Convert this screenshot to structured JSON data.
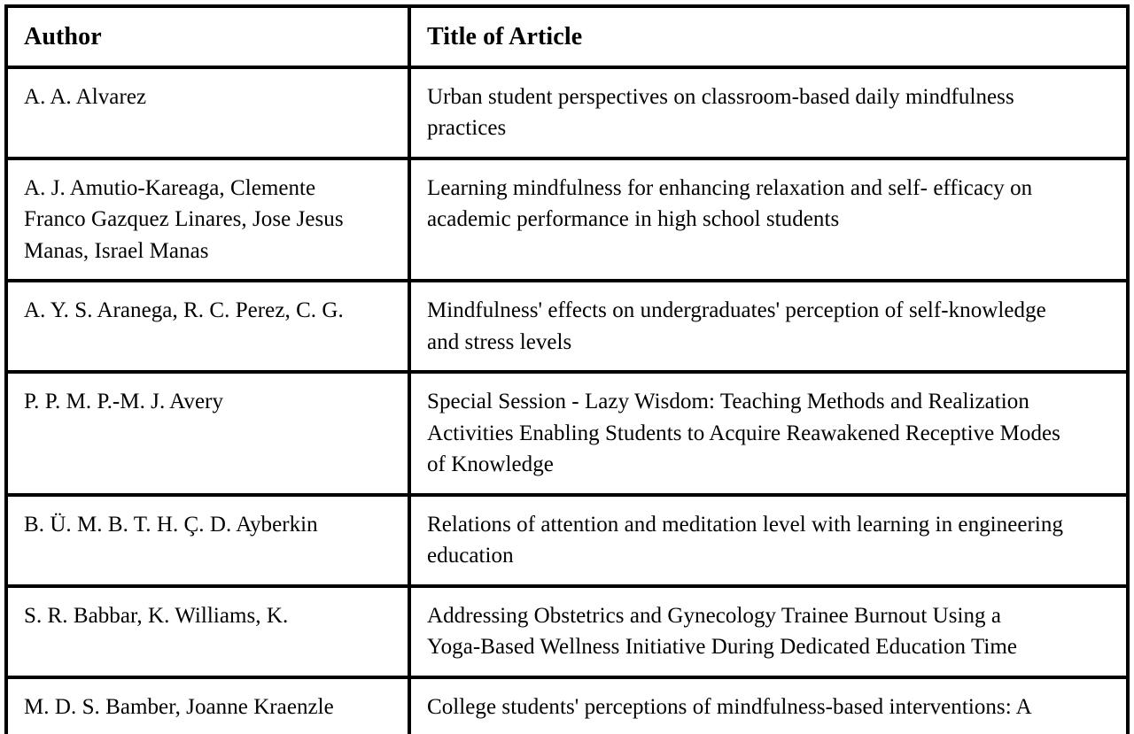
{
  "table": {
    "name": "author-title-table",
    "columns": [
      {
        "key": "author",
        "header": "Author"
      },
      {
        "key": "title",
        "header": "Title of Article"
      }
    ],
    "style": {
      "border_color": "#000000",
      "text_color": "#000000",
      "background": "#ffffff"
    },
    "rows": [
      {
        "author": "A. A. Alvarez",
        "title": "Urban student perspectives on classroom-based daily mindfulness practices",
        "author_lines": [
          "A. A. Alvarez"
        ],
        "title_lines": [
          "Urban student perspectives on classroom-based daily mindfulness",
          "practices"
        ]
      },
      {
        "author": "A. J. Amutio-Kareaga, Clemente Franco Gazquez Linares, Jose Jesus Manas, Israel Manas",
        "title": "Learning mindfulness for enhancing relaxation and self- efficacy on academic performance in high school students",
        "author_lines": [
          "A. J. Amutio-Kareaga, Clemente",
          "Franco Gazquez Linares, Jose Jesus",
          "Manas, Israel Manas"
        ],
        "title_lines": [
          "Learning mindfulness for enhancing relaxation and self- efficacy on",
          "academic performance in high school students"
        ]
      },
      {
        "author": "A. Y. S. Aranega, R. C. Perez, C. G.",
        "title": "Mindfulness' effects on undergraduates' perception of self-knowledge and stress levels",
        "author_lines": [
          "A. Y. S. Aranega, R. C. Perez, C. G."
        ],
        "title_lines": [
          "Mindfulness' effects on undergraduates' perception of self-knowledge",
          "and stress levels"
        ]
      },
      {
        "author": "P. P. M. P.-M. J. Avery",
        "title": "Special Session - Lazy Wisdom: Teaching Methods and Realization Activities Enabling Students to Acquire Reawakened Receptive Modes of Knowledge",
        "author_lines": [
          "P. P. M. P.-M. J. Avery"
        ],
        "title_lines": [
          "Special Session - Lazy Wisdom: Teaching Methods and Realization",
          "Activities Enabling Students to Acquire Reawakened Receptive Modes",
          "of Knowledge"
        ]
      },
      {
        "author": "B. Ü. M. B. T. H. Ç. D. Ayberkin",
        "title": "Relations of attention and meditation level with learning in engineering education",
        "author_lines": [
          "B. Ü. M. B. T. H. Ç. D. Ayberkin"
        ],
        "title_lines": [
          "Relations of attention and meditation level with learning in engineering",
          "education"
        ]
      },
      {
        "author": "S. R. Babbar, K. Williams, K.",
        "title": "Addressing Obstetrics and Gynecology Trainee Burnout Using a Yoga-Based Wellness Initiative During Dedicated Education Time",
        "author_lines": [
          "S. R. Babbar, K. Williams, K."
        ],
        "title_lines": [
          "Addressing Obstetrics and Gynecology Trainee Burnout Using a",
          "Yoga-Based Wellness Initiative During Dedicated Education Time"
        ]
      },
      {
        "author": "M. D. S. Bamber, Joanne Kraenzle",
        "title": "College students' perceptions of mindfulness-based interventions: A",
        "author_lines": [
          "M. D. S. Bamber, Joanne Kraenzle"
        ],
        "title_lines": [
          "College students' perceptions of mindfulness-based interventions: A"
        ]
      }
    ]
  }
}
